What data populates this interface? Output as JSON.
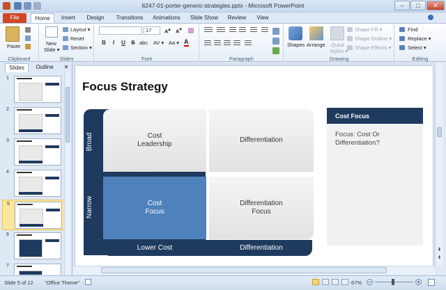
{
  "window": {
    "title": "6247-01-porter-generic-strategies.pptx - Microsoft PowerPoint"
  },
  "tabs": [
    "File",
    "Home",
    "Insert",
    "Design",
    "Transitions",
    "Animations",
    "Slide Show",
    "Review",
    "View"
  ],
  "ribbon": {
    "clipboard": {
      "label": "Clipboard",
      "paste": "Paste"
    },
    "slides": {
      "label": "Slides",
      "new_slide": "New",
      "new_slide2": "Slide ▾",
      "layout": "Layout ▾",
      "reset": "Reset",
      "section": "Section ▾"
    },
    "font": {
      "label": "Font",
      "size": "17",
      "bold": "B",
      "italic": "I",
      "underline": "U",
      "strike": "S",
      "shadow": "abc",
      "spacing": "AV ▾",
      "case": "Aa ▾",
      "color": "A"
    },
    "paragraph": {
      "label": "Paragraph"
    },
    "drawing": {
      "label": "Drawing",
      "shapes": "Shapes",
      "arrange": "Arrange",
      "quick": "Quick",
      "styles": "Styles ▾",
      "fill": "Shape Fill ▾",
      "outline": "Shape Outline ▾",
      "effects": "Shape Effects ▾"
    },
    "editing": {
      "label": "Editing",
      "find": "Find",
      "replace": "Replace ▾",
      "select": "Select ▾"
    }
  },
  "panel": {
    "tab_slides": "Slides",
    "tab_outline": "Outline",
    "close": "✕",
    "thumbs": [
      {
        "num": "1"
      },
      {
        "num": "2"
      },
      {
        "num": "3"
      },
      {
        "num": "4"
      },
      {
        "num": "5"
      },
      {
        "num": "6"
      },
      {
        "num": "7"
      }
    ]
  },
  "slide": {
    "title": "Focus Strategy",
    "row_broad": "Broad",
    "row_narrow": "Narrow",
    "cell_cost_leadership_1": "Cost",
    "cell_cost_leadership_2": "Leadership",
    "cell_differentiation": "Differentiation",
    "cell_cost_focus_1": "Cost",
    "cell_cost_focus_2": "Focus",
    "cell_diff_focus_1": "Differentiation",
    "cell_diff_focus_2": "Focus",
    "col_lower_cost": "Lower Cost",
    "col_differentiation": "Differentiation",
    "side_header": "Cost Focus",
    "side_text_1": "Focus: Cost Or",
    "side_text_2": "Differentiation?"
  },
  "status": {
    "slide": "Slide 5 of 12",
    "theme": "\"Office Theme\"",
    "zoom": "67%"
  },
  "colors": {
    "navy": "#1f3a5f",
    "blue": "#4f81bd",
    "file_tab": "#d24726"
  }
}
